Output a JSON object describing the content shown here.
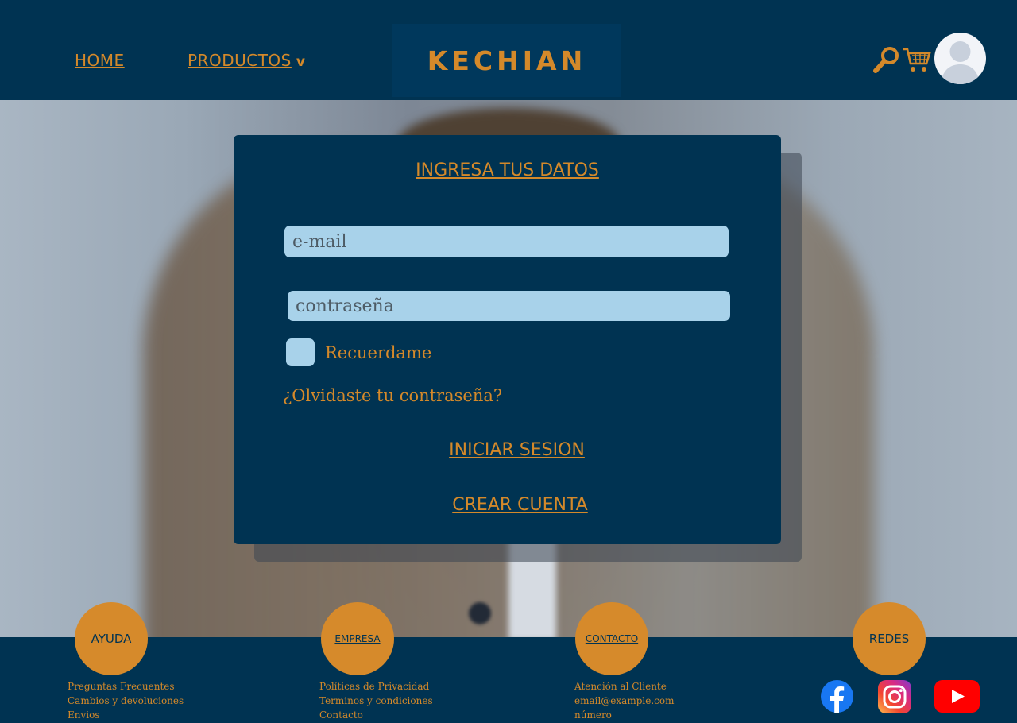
{
  "header": {
    "nav_home": "HOME",
    "nav_products": "PRODUCTOS",
    "products_chevron": "v",
    "logo": "KECHIAN"
  },
  "login": {
    "title": "INGRESA TUS DATOS",
    "email_placeholder": "e-mail",
    "password_placeholder": "contraseña",
    "remember_label": "Recuerdame",
    "forgot_link": "¿Olvidaste tu contraseña?",
    "login_button": "INICIAR SESION",
    "create_button": "CREAR CUENTA"
  },
  "footer": {
    "ayuda": {
      "title": "AYUDA",
      "items": [
        "Preguntas Frecuentes",
        "Cambios y devoluciones",
        "Envios"
      ]
    },
    "empresa": {
      "title": "EMPRESA",
      "items": [
        "Políticas de Privacidad",
        "Terminos y condiciones",
        "Contacto"
      ]
    },
    "contacto": {
      "title": "CONTACTO",
      "items": [
        "Atención al Cliente",
        "email@example.com",
        "número"
      ]
    },
    "redes": {
      "title": "REDES",
      "icons": [
        "facebook-icon",
        "instagram-icon",
        "youtube-icon"
      ]
    }
  },
  "colors": {
    "navy": "#003352",
    "accent": "#d4892a",
    "input_bg": "#a8d2ea",
    "circle": "#d68a2b"
  }
}
